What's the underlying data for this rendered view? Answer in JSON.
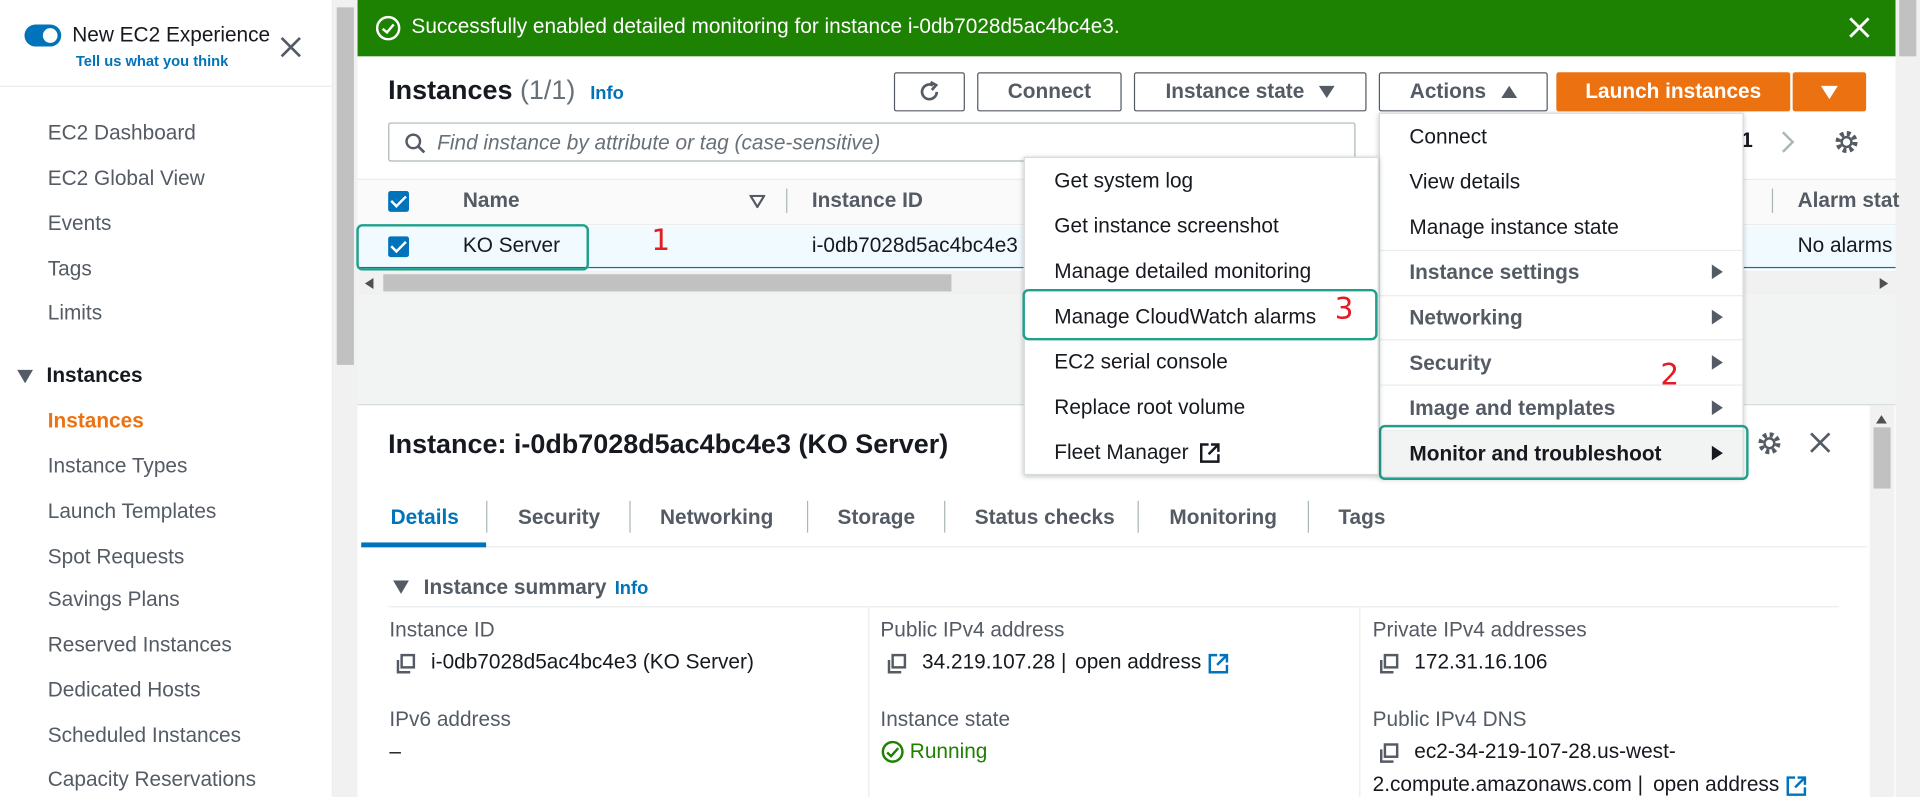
{
  "sidebar": {
    "toggle_title": "New EC2 Experience",
    "toggle_link": "Tell us what you think",
    "items": [
      "EC2 Dashboard",
      "EC2 Global View",
      "Events",
      "Tags",
      "Limits"
    ],
    "section": "Instances",
    "section_items": [
      "Instances",
      "Instance Types",
      "Launch Templates",
      "Spot Requests",
      "Savings Plans",
      "Reserved Instances",
      "Dedicated Hosts",
      "Scheduled Instances",
      "Capacity Reservations"
    ]
  },
  "banner": {
    "message": "Successfully enabled detailed monitoring for instance i-0db7028d5ac4bc4e3.",
    "color": "#1d8102"
  },
  "header": {
    "title": "Instances",
    "count": "(1/1)",
    "info": "Info"
  },
  "toolbar": {
    "connect": "Connect",
    "instance_state": "Instance state",
    "actions": "Actions",
    "launch": "Launch instances"
  },
  "search": {
    "placeholder": "Find instance by attribute or tag (case-sensitive)"
  },
  "pagination": {
    "page": "1"
  },
  "table": {
    "columns": {
      "name": "Name",
      "instance_id": "Instance ID",
      "alarm": "Alarm stat"
    },
    "rows": [
      {
        "name": "KO Server",
        "instance_id": "i-0db7028d5ac4bc4e3",
        "alarm": "No alarms"
      }
    ]
  },
  "actions_menu": {
    "items": [
      "Connect",
      "View details",
      "Manage instance state"
    ],
    "submenus": [
      "Instance settings",
      "Networking",
      "Security",
      "Image and templates",
      "Monitor and troubleshoot"
    ]
  },
  "monitor_menu": {
    "items": [
      "Get system log",
      "Get instance screenshot",
      "Manage detailed monitoring",
      "Manage CloudWatch alarms",
      "EC2 serial console",
      "Replace root volume",
      "Fleet Manager"
    ]
  },
  "annotations": {
    "one": "1",
    "two": "2",
    "three": "3"
  },
  "detail": {
    "title": "Instance: i-0db7028d5ac4bc4e3 (KO Server)",
    "tabs": [
      "Details",
      "Security",
      "Networking",
      "Storage",
      "Status checks",
      "Monitoring",
      "Tags"
    ],
    "summary": "Instance summary",
    "info": "Info",
    "fields": {
      "instance_id_label": "Instance ID",
      "instance_id_value": "i-0db7028d5ac4bc4e3 (KO Server)",
      "public_ipv4_label": "Public IPv4 address",
      "public_ipv4_value": "34.219.107.28 |",
      "open_address": "open address",
      "private_ipv4_label": "Private IPv4 addresses",
      "private_ipv4_value": "172.31.16.106",
      "ipv6_label": "IPv6 address",
      "ipv6_value": "–",
      "state_label": "Instance state",
      "state_value": "Running",
      "dns_label": "Public IPv4 DNS",
      "dns_line1": "ec2-34-219-107-28.us-west-",
      "dns_line2": "2.compute.amazonaws.com |"
    }
  },
  "colors": {
    "accent": "#ec7211",
    "link": "#0073bb",
    "highlight": "#1fa08c",
    "annotation": "#e31b23",
    "success": "#1d8102"
  }
}
